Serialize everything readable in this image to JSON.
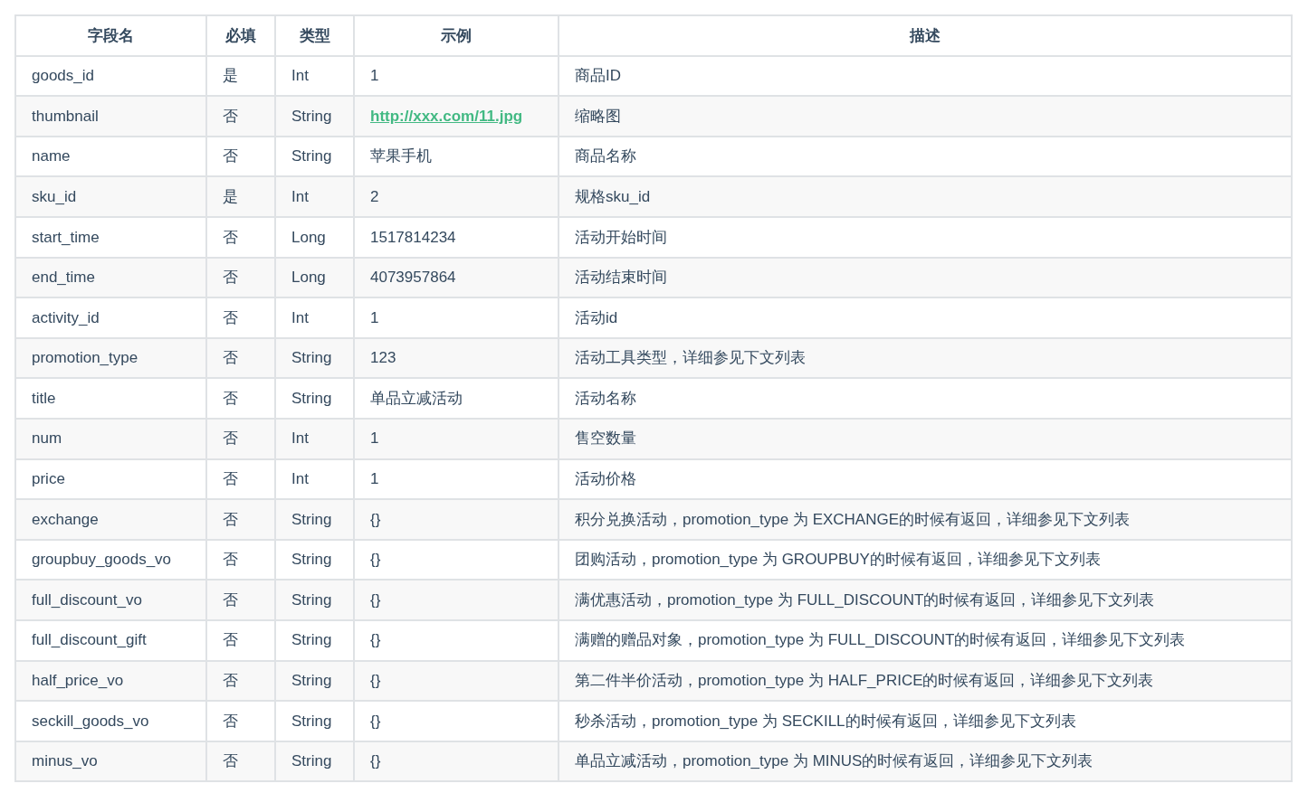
{
  "table": {
    "columns": [
      "字段名",
      "必填",
      "类型",
      "示例",
      "描述"
    ],
    "rows": [
      {
        "field": "goods_id",
        "required": "是",
        "type": "Int",
        "example": {
          "text": "1",
          "kind": "text"
        },
        "description": "商品ID"
      },
      {
        "field": "thumbnail",
        "required": "否",
        "type": "String",
        "example": {
          "text": "http://xxx.com/11.jpg",
          "kind": "link"
        },
        "description": "缩略图"
      },
      {
        "field": "name",
        "required": "否",
        "type": "String",
        "example": {
          "text": "苹果手机",
          "kind": "text"
        },
        "description": "商品名称"
      },
      {
        "field": "sku_id",
        "required": "是",
        "type": "Int",
        "example": {
          "text": "2",
          "kind": "text"
        },
        "description": "规格sku_id"
      },
      {
        "field": "start_time",
        "required": "否",
        "type": "Long",
        "example": {
          "text": "1517814234",
          "kind": "text"
        },
        "description": "活动开始时间"
      },
      {
        "field": "end_time",
        "required": "否",
        "type": "Long",
        "example": {
          "text": "4073957864",
          "kind": "text"
        },
        "description": "活动结束时间"
      },
      {
        "field": "activity_id",
        "required": "否",
        "type": "Int",
        "example": {
          "text": "1",
          "kind": "text"
        },
        "description": "活动id"
      },
      {
        "field": "promotion_type",
        "required": "否",
        "type": "String",
        "example": {
          "text": "123",
          "kind": "text"
        },
        "description": "活动工具类型，详细参见下文列表"
      },
      {
        "field": "title",
        "required": "否",
        "type": "String",
        "example": {
          "text": "单品立减活动",
          "kind": "text"
        },
        "description": "活动名称"
      },
      {
        "field": "num",
        "required": "否",
        "type": "Int",
        "example": {
          "text": "1",
          "kind": "text"
        },
        "description": "售空数量"
      },
      {
        "field": "price",
        "required": "否",
        "type": "Int",
        "example": {
          "text": "1",
          "kind": "text"
        },
        "description": "活动价格"
      },
      {
        "field": "exchange",
        "required": "否",
        "type": "String",
        "example": {
          "text": "{}",
          "kind": "text"
        },
        "description": "积分兑换活动，promotion_type 为 EXCHANGE的时候有返回，详细参见下文列表"
      },
      {
        "field": "groupbuy_goods_vo",
        "required": "否",
        "type": "String",
        "example": {
          "text": "{}",
          "kind": "text"
        },
        "description": "团购活动，promotion_type 为 GROUPBUY的时候有返回，详细参见下文列表"
      },
      {
        "field": "full_discount_vo",
        "required": "否",
        "type": "String",
        "example": {
          "text": "{}",
          "kind": "text"
        },
        "description": "满优惠活动，promotion_type 为 FULL_DISCOUNT的时候有返回，详细参见下文列表"
      },
      {
        "field": "full_discount_gift",
        "required": "否",
        "type": "String",
        "example": {
          "text": "{}",
          "kind": "text"
        },
        "description": "满赠的赠品对象，promotion_type 为 FULL_DISCOUNT的时候有返回，详细参见下文列表"
      },
      {
        "field": "half_price_vo",
        "required": "否",
        "type": "String",
        "example": {
          "text": "{}",
          "kind": "text"
        },
        "description": "第二件半价活动，promotion_type 为 HALF_PRICE的时候有返回，详细参见下文列表"
      },
      {
        "field": "seckill_goods_vo",
        "required": "否",
        "type": "String",
        "example": {
          "text": "{}",
          "kind": "text"
        },
        "description": "秒杀活动，promotion_type 为 SECKILL的时候有返回，详细参见下文列表"
      },
      {
        "field": "minus_vo",
        "required": "否",
        "type": "String",
        "example": {
          "text": "{}",
          "kind": "text"
        },
        "description": "单品立减活动，promotion_type 为 MINUS的时候有返回，详细参见下文列表"
      }
    ]
  }
}
